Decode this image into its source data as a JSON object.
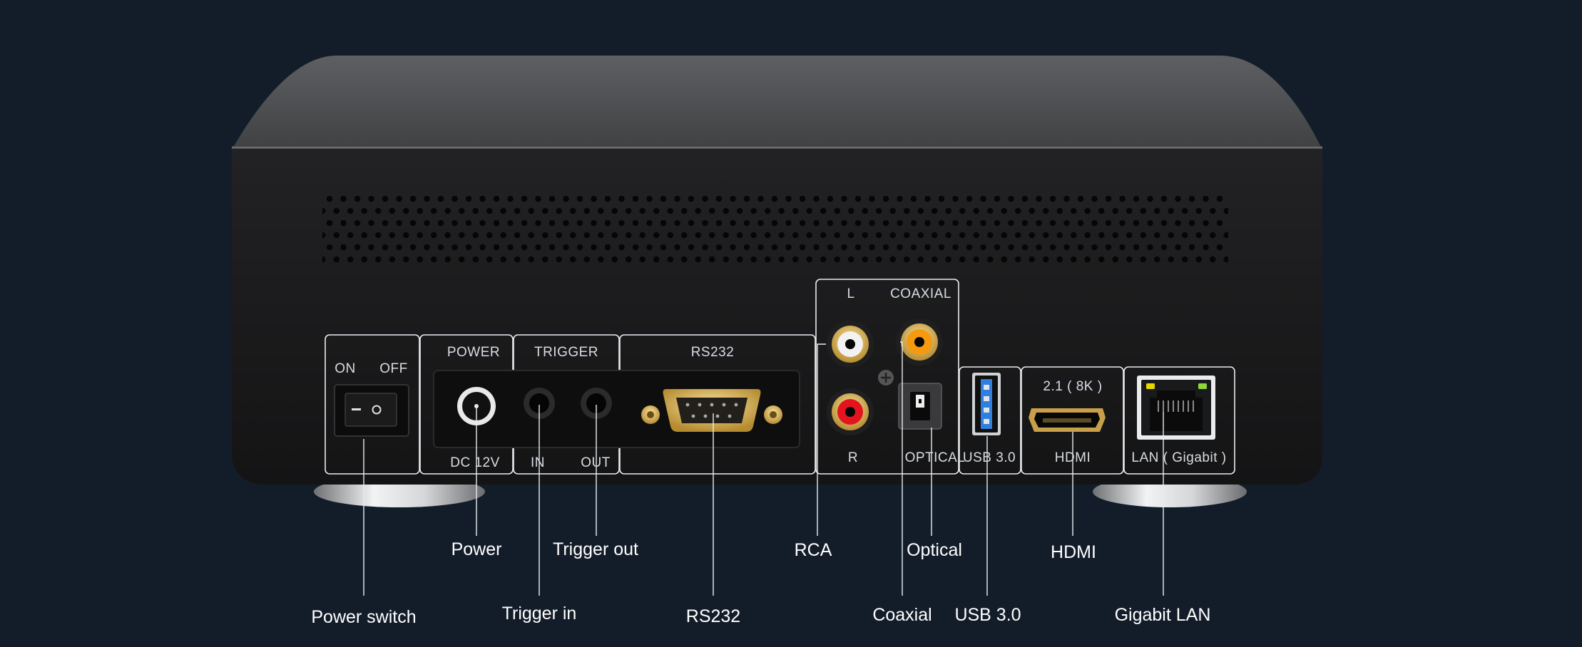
{
  "panel_labels": {
    "on": "ON",
    "off": "OFF",
    "power": "POWER",
    "dc": "DC 12V",
    "trigger": "TRIGGER",
    "trigger_in": "IN",
    "trigger_out": "OUT",
    "rs232": "RS232",
    "rca_l": "L",
    "rca_r": "R",
    "coaxial": "COAXIAL",
    "optical": "OPTICAL",
    "usb": "USB 3.0",
    "hdmi_version": "2.1 ( 8K )",
    "hdmi": "HDMI",
    "lan": "LAN ( Gigabit )"
  },
  "callouts": {
    "power_switch": "Power switch",
    "power": "Power",
    "trigger_in": "Trigger in",
    "trigger_out": "Trigger out",
    "rs232": "RS232",
    "rca": "RCA",
    "coaxial": "Coaxial",
    "optical": "Optical",
    "usb": "USB 3.0",
    "hdmi": "HDMI",
    "lan": "Gigabit LAN"
  },
  "colors": {
    "background": "#131d2a",
    "chassis": "#1b1b1d",
    "top_panel": "#555759",
    "label_line": "#e8ecef",
    "rca_white": "#f2f2f2",
    "rca_red": "#e3141e",
    "coaxial_orange": "#f59a10",
    "usb_blue": "#2f7fe0",
    "gold": "#d8b25a",
    "lan_led_yellow": "#e6d600",
    "lan_led_green": "#8fd63a"
  }
}
